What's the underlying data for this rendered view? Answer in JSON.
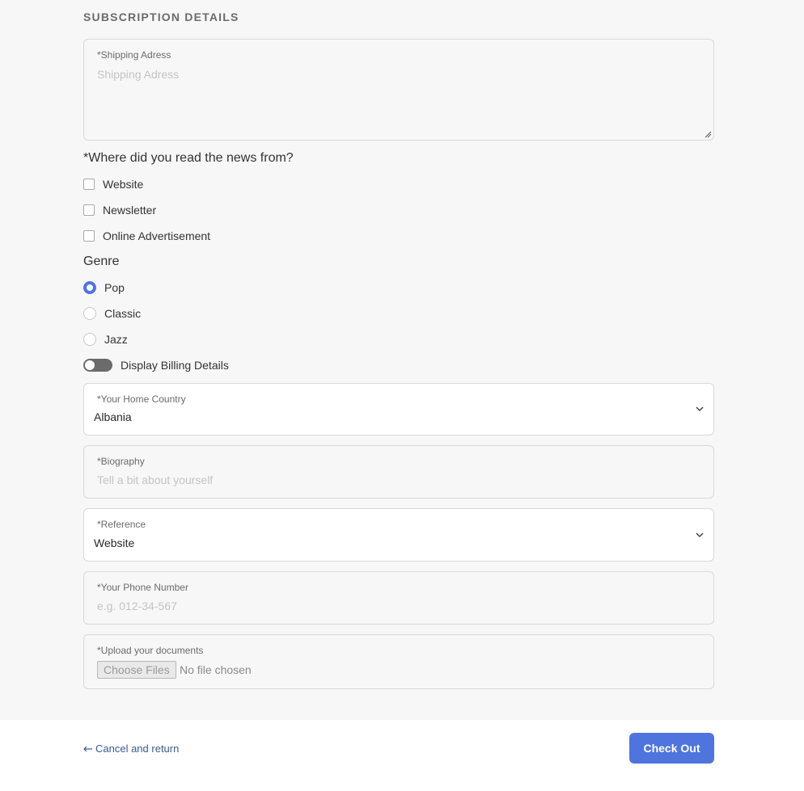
{
  "section": {
    "title": "SUBSCRIPTION DETAILS"
  },
  "shipping": {
    "label": "*Shipping Adress",
    "placeholder": "Shipping Adress"
  },
  "news_source": {
    "question": "*Where did you read the news from?",
    "options": [
      {
        "label": "Website",
        "checked": false
      },
      {
        "label": "Newsletter",
        "checked": false
      },
      {
        "label": "Online Advertisement",
        "checked": false
      }
    ]
  },
  "genre": {
    "question": "Genre",
    "options": [
      {
        "label": "Pop",
        "selected": true
      },
      {
        "label": "Classic",
        "selected": false
      },
      {
        "label": "Jazz",
        "selected": false
      }
    ]
  },
  "billing_toggle": {
    "label": "Display Billing Details",
    "on": false
  },
  "country": {
    "label": "*Your Home Country",
    "value": "Albania"
  },
  "biography": {
    "label": "*Biography",
    "placeholder": "Tell a bit about yourself"
  },
  "reference": {
    "label": "*Reference",
    "value": "Website"
  },
  "phone": {
    "label": "*Your Phone Number",
    "placeholder": "e.g. 012-34-567"
  },
  "upload": {
    "label": "*Upload your documents",
    "button_label": "Choose Files",
    "status": "No file chosen"
  },
  "footer": {
    "cancel_label": "Cancel and return",
    "checkout_label": "Check Out"
  },
  "colors": {
    "accent": "#4f74dd",
    "link": "#3a5a8c",
    "page_bg": "#f7f7f7"
  },
  "icons": {
    "cancel": "arrow-left-icon",
    "select": "chevron-down-icon",
    "resize": "resize-grip-icon"
  }
}
